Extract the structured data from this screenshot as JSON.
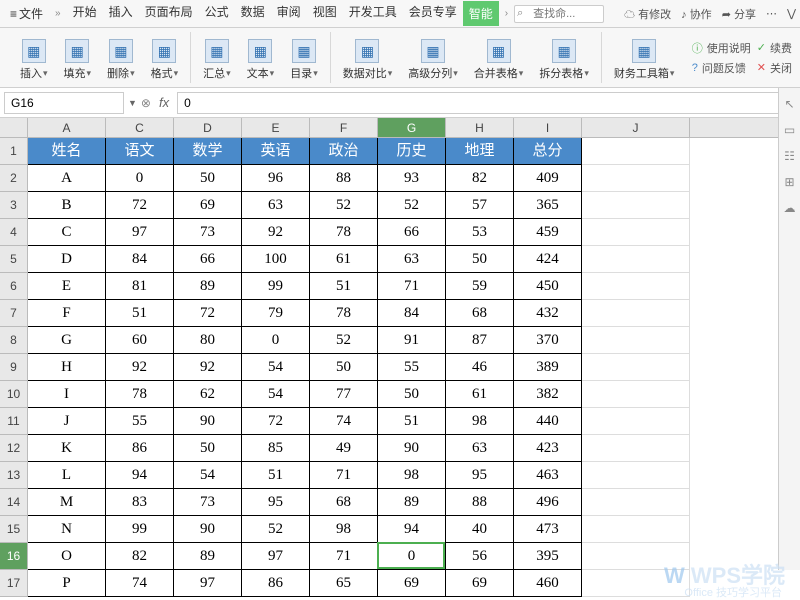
{
  "menu": {
    "file": "文件",
    "tabs": [
      "开始",
      "插入",
      "页面布局",
      "公式",
      "数据",
      "审阅",
      "视图",
      "开发工具",
      "会员专享",
      "智能"
    ],
    "search_placeholder": "查找命...",
    "right": {
      "modified": "有修改",
      "collab": "协作",
      "share": "分享"
    }
  },
  "ribbon": {
    "items": [
      "插入",
      "填充",
      "删除",
      "格式",
      "汇总",
      "文本",
      "目录",
      "数据对比",
      "高级分列",
      "合并表格",
      "拆分表格",
      "财务工具箱"
    ],
    "right": {
      "usage": "使用说明",
      "continue": "续费",
      "feedback": "问题反馈",
      "close": "关闭"
    }
  },
  "cellref": {
    "value": "G16",
    "formula": "0"
  },
  "columns": [
    "A",
    "C",
    "D",
    "E",
    "F",
    "G",
    "H",
    "I",
    "J"
  ],
  "headers": [
    "姓名",
    "语文",
    "数学",
    "英语",
    "政治",
    "历史",
    "地理",
    "总分"
  ],
  "rows": [
    [
      "A",
      "0",
      "50",
      "96",
      "88",
      "93",
      "82",
      "409"
    ],
    [
      "B",
      "72",
      "69",
      "63",
      "52",
      "52",
      "57",
      "365"
    ],
    [
      "C",
      "97",
      "73",
      "92",
      "78",
      "66",
      "53",
      "459"
    ],
    [
      "D",
      "84",
      "66",
      "100",
      "61",
      "63",
      "50",
      "424"
    ],
    [
      "E",
      "81",
      "89",
      "99",
      "51",
      "71",
      "59",
      "450"
    ],
    [
      "F",
      "51",
      "72",
      "79",
      "78",
      "84",
      "68",
      "432"
    ],
    [
      "G",
      "60",
      "80",
      "0",
      "52",
      "91",
      "87",
      "370"
    ],
    [
      "H",
      "92",
      "92",
      "54",
      "50",
      "55",
      "46",
      "389"
    ],
    [
      "I",
      "78",
      "62",
      "54",
      "77",
      "50",
      "61",
      "382"
    ],
    [
      "J",
      "55",
      "90",
      "72",
      "74",
      "51",
      "98",
      "440"
    ],
    [
      "K",
      "86",
      "50",
      "85",
      "49",
      "90",
      "63",
      "423"
    ],
    [
      "L",
      "94",
      "54",
      "51",
      "71",
      "98",
      "95",
      "463"
    ],
    [
      "M",
      "83",
      "73",
      "95",
      "68",
      "89",
      "88",
      "496"
    ],
    [
      "N",
      "99",
      "90",
      "52",
      "98",
      "94",
      "40",
      "473"
    ],
    [
      "O",
      "82",
      "89",
      "97",
      "71",
      "0",
      "56",
      "395"
    ],
    [
      "P",
      "74",
      "97",
      "86",
      "65",
      "69",
      "69",
      "460"
    ]
  ],
  "selected": {
    "row": 16,
    "col_index": 5
  },
  "watermark": {
    "main": "WPS学院",
    "sub": "Office 技巧学习平台"
  }
}
